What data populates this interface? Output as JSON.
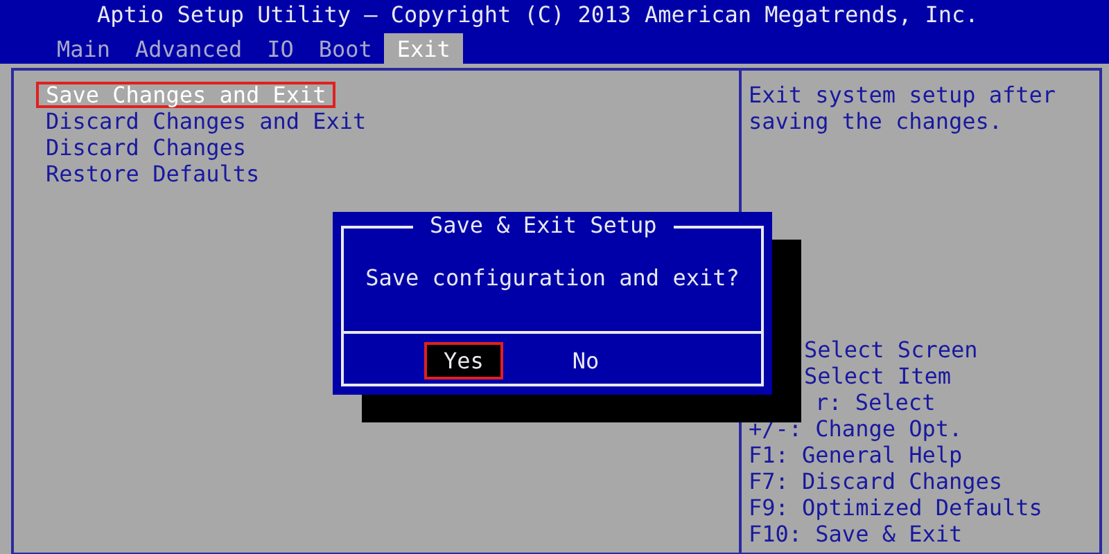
{
  "header": {
    "title": "Aptio Setup Utility – Copyright (C) 2013 American Megatrends, Inc."
  },
  "tabs": [
    {
      "label": "Main",
      "selected": false
    },
    {
      "label": "Advanced",
      "selected": false
    },
    {
      "label": "IO",
      "selected": false
    },
    {
      "label": "Boot",
      "selected": false
    },
    {
      "label": "Exit",
      "selected": true
    }
  ],
  "menu": [
    {
      "label": "Save Changes and Exit",
      "selected": true,
      "marked": true
    },
    {
      "label": "Discard Changes and Exit",
      "selected": false,
      "marked": false
    },
    {
      "label": "Discard Changes",
      "selected": false,
      "marked": false
    },
    {
      "label": "Restore Defaults",
      "selected": false,
      "marked": false
    }
  ],
  "help": {
    "description": "Exit system setup after saving the changes.",
    "keys": [
      "Select Screen",
      "Select Item",
      "r: Select",
      "+/-: Change Opt.",
      "F1: General Help",
      "F7: Discard Changes",
      "F9: Optimized Defaults",
      "F10: Save & Exit"
    ]
  },
  "dialog": {
    "title": "Save & Exit Setup",
    "message": "Save configuration and exit?",
    "buttons": [
      {
        "label": "Yes",
        "selected": true,
        "marked": true
      },
      {
        "label": "No",
        "selected": false,
        "marked": false
      }
    ]
  }
}
